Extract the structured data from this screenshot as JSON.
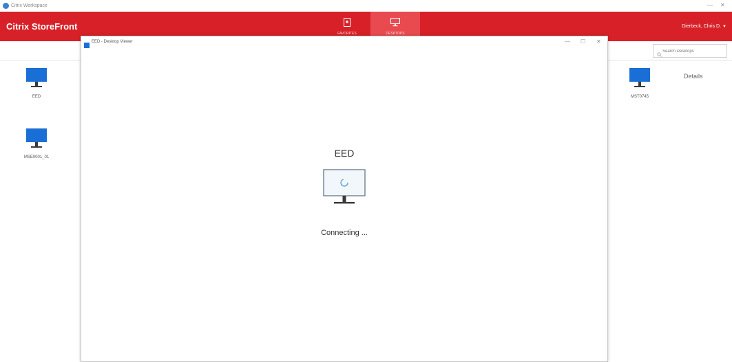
{
  "os_window": {
    "title": "Citrix Workspace",
    "minimize": "—",
    "close": "✕"
  },
  "header": {
    "brand": "Citrix StoreFront",
    "tabs": [
      {
        "label": "FAVORITES",
        "icon": "bookmark-icon",
        "active": false
      },
      {
        "label": "DESKTOPS",
        "icon": "monitor-icon",
        "active": true
      }
    ],
    "user": "Dierbeck, Chris D.",
    "caret": "▼"
  },
  "search": {
    "placeholder": "Search Desktops"
  },
  "desktops": [
    {
      "name": "EED",
      "icon": "monitor-icon"
    },
    {
      "name": "MSE0001_01",
      "icon": "monitor-icon"
    },
    {
      "name": "MST0745",
      "icon": "monitor-icon"
    }
  ],
  "details_label": "Details",
  "viewer": {
    "title": "EED - Desktop Viewer",
    "minimize": "—",
    "maximize": "☐",
    "close": "✕",
    "desktop_name": "EED",
    "status": "Connecting ..."
  },
  "colors": {
    "header": "#d72027",
    "active_tab": "#e84a50",
    "monitor_blue": "#1a6fd6"
  }
}
